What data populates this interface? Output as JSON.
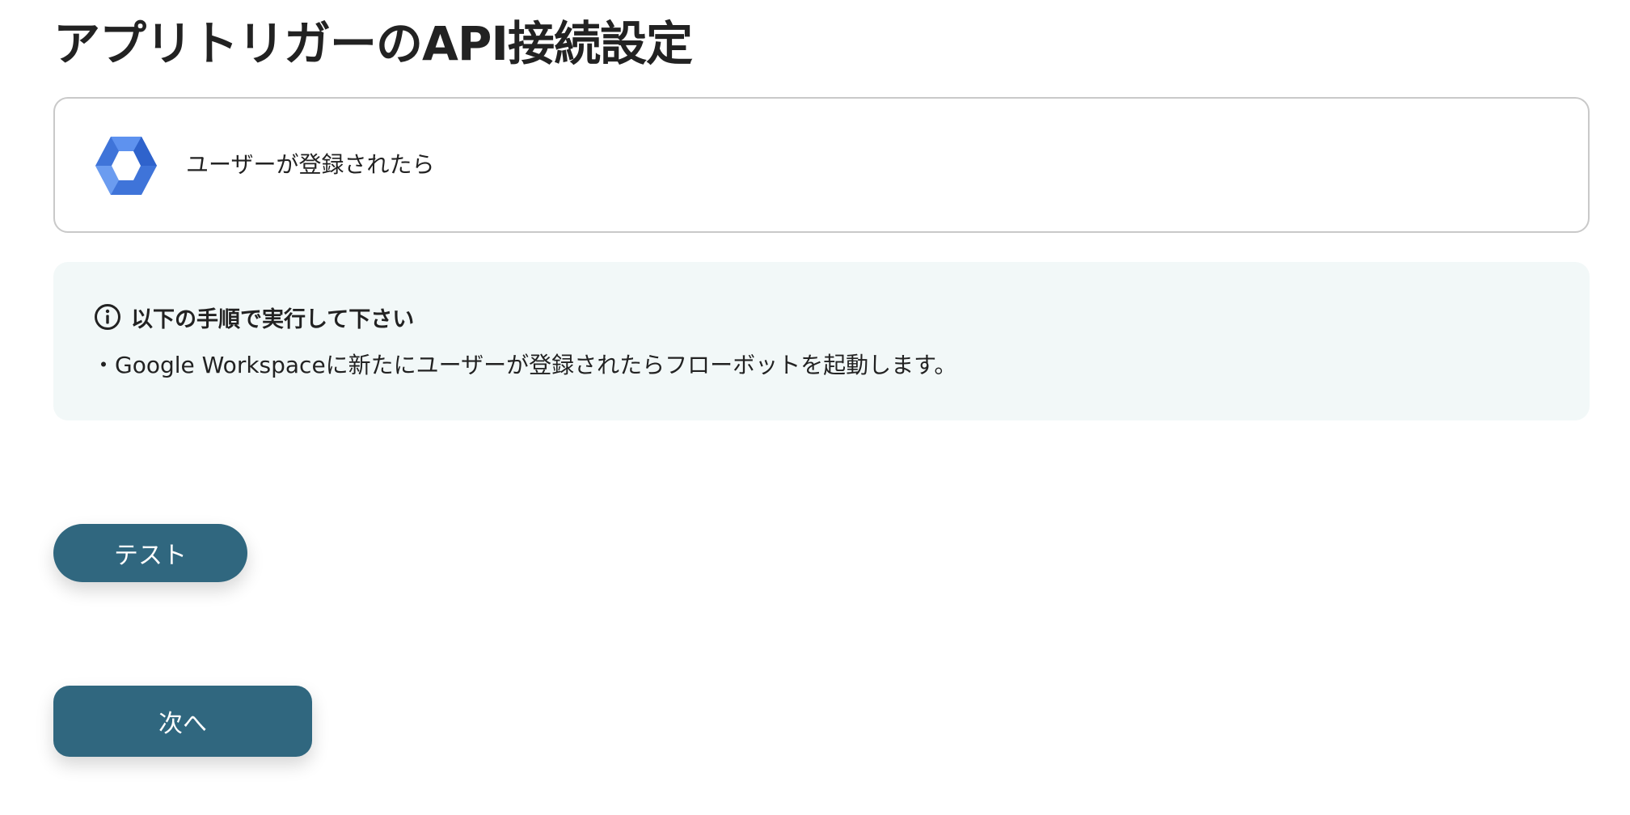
{
  "page": {
    "title": "アプリトリガーのAPI接続設定"
  },
  "trigger": {
    "icon": "google-workspace-icon",
    "label": "ユーザーが登録されたら"
  },
  "info": {
    "icon": "info-circle-icon",
    "heading": "以下の手順で実行して下さい",
    "body": "・Google Workspaceに新たにユーザーが登録されたらフローボットを起動します。"
  },
  "buttons": {
    "test_label": "テスト",
    "next_label": "次へ"
  },
  "colors": {
    "button_bg": "#30677f",
    "info_bg": "#f2f8f8",
    "card_border": "#c9c9c9",
    "logo_blue": "#4285f4"
  }
}
